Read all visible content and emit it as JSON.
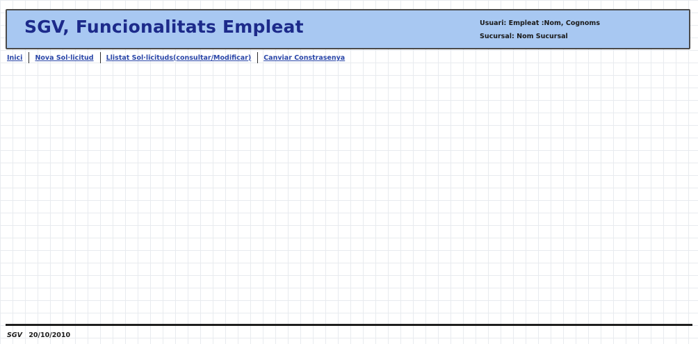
{
  "header": {
    "title": "SGV, Funcionalitats Empleat",
    "user_label": "Usuari:",
    "user_value": "Empleat :Nom, Cognoms",
    "branch_label": "Sucursal:",
    "branch_value": "Nom Sucursal"
  },
  "nav": {
    "items": [
      {
        "label": "Inici"
      },
      {
        "label": "Nova Sol·licitud"
      },
      {
        "label": "Llistat Sol·licituds(consultar/Modificar)"
      },
      {
        "label": "Canviar Constrasenya"
      }
    ]
  },
  "footer": {
    "brand": "SGV",
    "date": "20/10/2010"
  },
  "colors": {
    "header_bg": "#a8c8f2",
    "title": "#1c2a8a",
    "link": "#2a46a8"
  }
}
